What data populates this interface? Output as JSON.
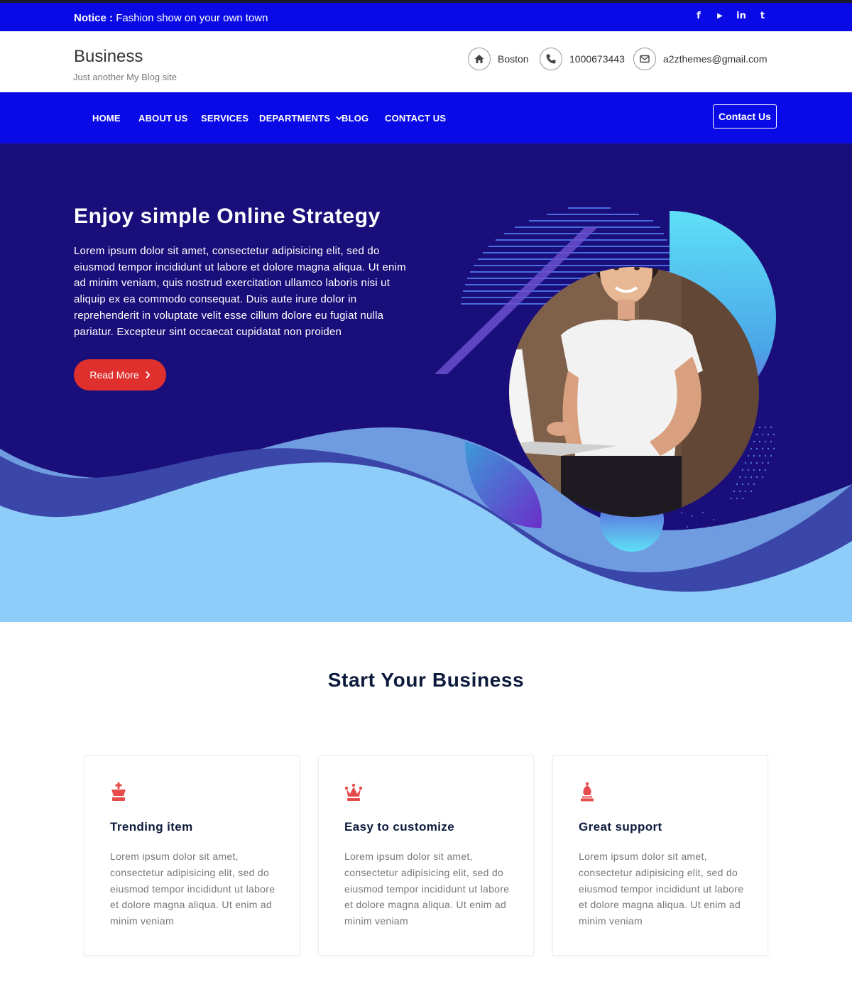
{
  "notice": {
    "label": "Notice :",
    "text": "Fashion show on your own town"
  },
  "socials": [
    {
      "icon": "facebook-icon",
      "glyph": "f"
    },
    {
      "icon": "youtube-icon",
      "glyph": "▶"
    },
    {
      "icon": "linkedin-icon",
      "glyph": "in"
    },
    {
      "icon": "twitter-icon",
      "glyph": "t"
    }
  ],
  "brand": {
    "title": "Business",
    "tagline": "Just another My Blog site"
  },
  "contact": {
    "location": "Boston",
    "phone": "1000673443",
    "email": "a2zthemes@gmail.com"
  },
  "nav": {
    "items": [
      "HOME",
      "ABOUT US",
      "SERVICES",
      "DEPARTMENTS",
      "BLOG",
      "CONTACT US"
    ],
    "cta": "Contact Us"
  },
  "hero": {
    "title": "Enjoy simple Online Strategy",
    "text": "Lorem ipsum dolor sit amet, consectetur adipisicing elit, sed do eiusmod tempor incididunt ut labore et dolore magna aliqua. Ut enim ad minim veniam, quis nostrud exercitation ullamco laboris nisi ut aliquip ex ea commodo consequat. Duis aute irure dolor in reprehenderit in voluptate velit esse cillum dolore eu fugiat nulla pariatur. Excepteur sint occaecat cupidatat non proiden",
    "button": "Read More"
  },
  "section": {
    "title": "Start Your Business",
    "cards": [
      {
        "icon": "chess-king-icon",
        "title": "Trending item",
        "text": "Lorem ipsum dolor sit amet, consectetur adipisicing elit, sed do eiusmod tempor incididunt ut labore et dolore magna aliqua. Ut enim ad minim veniam"
      },
      {
        "icon": "crown-icon",
        "title": "Easy to customize",
        "text": "Lorem ipsum dolor sit amet, consectetur adipisicing elit, sed do eiusmod tempor incididunt ut labore et dolore magna aliqua. Ut enim ad minim veniam"
      },
      {
        "icon": "chess-bishop-icon",
        "title": "Great support",
        "text": "Lorem ipsum dolor sit amet, consectetur adipisicing elit, sed do eiusmod tempor incididunt ut labore et dolore magna aliqua. Ut enim ad minim veniam"
      }
    ]
  },
  "colors": {
    "primary": "#0a0ae6",
    "hero_bg": "#1a0f7a",
    "accent": "#e0302e",
    "wave_light": "#8ecdf9",
    "heading": "#0c1a3c"
  }
}
